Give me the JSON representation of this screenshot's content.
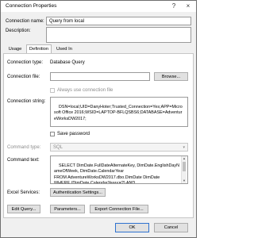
{
  "window": {
    "title": "Connection Properties",
    "help": "?",
    "close": "×"
  },
  "connection_name": {
    "label": "Connection name:",
    "value": "Query from local"
  },
  "description": {
    "label": "Description:",
    "value": ""
  },
  "tabs": [
    {
      "label": "Usage"
    },
    {
      "label": "Definition"
    },
    {
      "label": "Used In"
    }
  ],
  "definition": {
    "connection_type": {
      "label": "Connection type:",
      "value": "Database Query"
    },
    "connection_file": {
      "label": "Connection file:",
      "value": "",
      "browse": "Browse..."
    },
    "always_use_file": {
      "label": "Always use connection file",
      "checked": false
    },
    "connection_string": {
      "label": "Connection string:",
      "value": "DSN=local;UID=DanyHoter;Trusted_Connection=Yes;APP=Microsoft Office 2016;WSID=LAPTOP-BFLQSBS6;DATABASE=AdventureWorksDW2017;"
    },
    "save_password": {
      "label": "Save password",
      "checked": false
    },
    "command_type": {
      "label": "Command type:",
      "value": "SQL"
    },
    "command_text": {
      "label": "Command text:",
      "value": "SELECT DimDate.FullDateAlternateKey, DimDate.EnglishDayNameOfWeek, DimDate.CalendarYear\r\nFROM AdventureWorksDW2017.dbo.DimDate DimDate\r\nWHERE (DimDate.CalendarYear<=?) AND"
    },
    "excel_services": {
      "label": "Excel Services:",
      "button": "Authentication Settings..."
    },
    "buttons": {
      "edit_query": "Edit Query...",
      "parameters": "Parameters...",
      "export": "Export Connection File..."
    }
  },
  "footer": {
    "ok": "OK",
    "cancel": "Cancel"
  }
}
